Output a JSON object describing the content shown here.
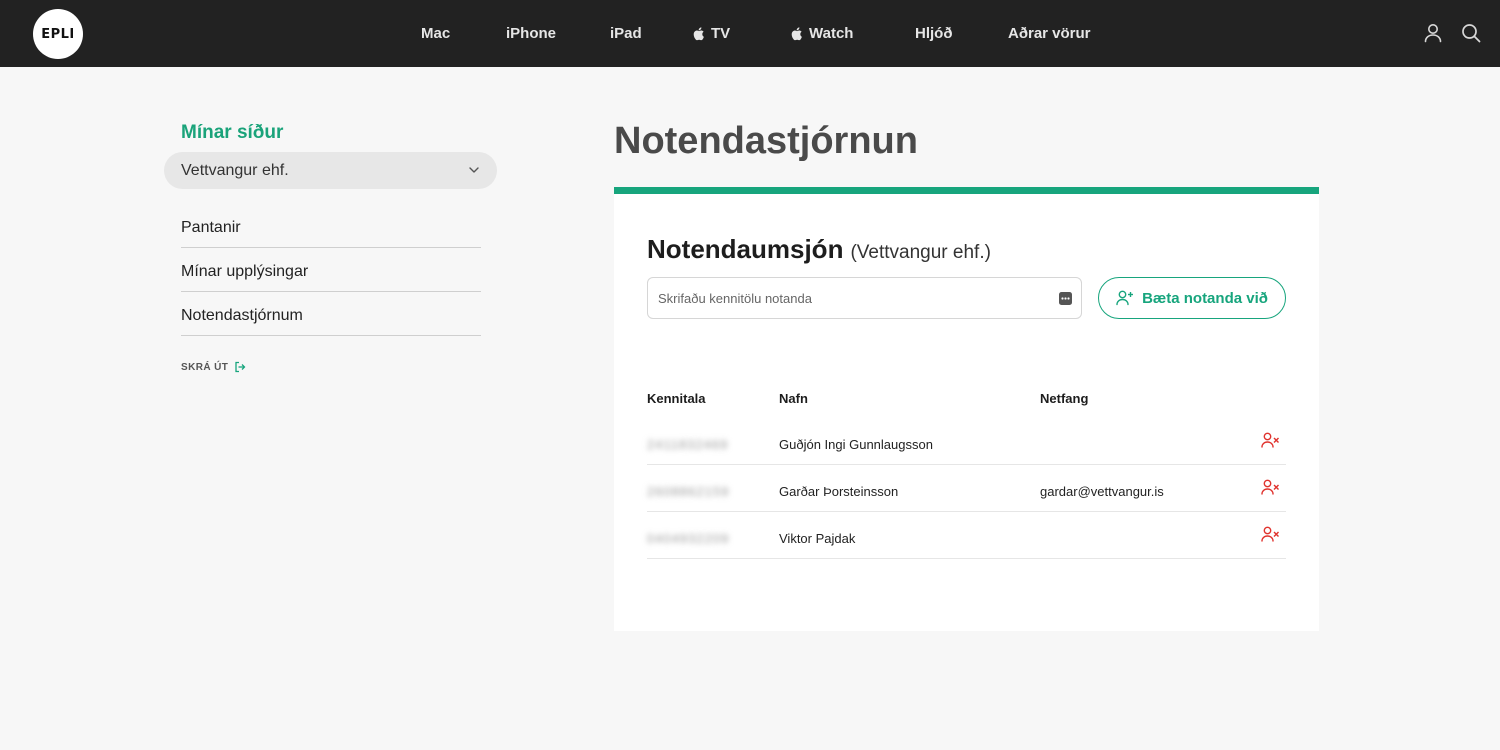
{
  "header": {
    "logo_text": "EPLI",
    "nav": [
      {
        "label": "Mac",
        "apple": false
      },
      {
        "label": "iPhone",
        "apple": false
      },
      {
        "label": "iPad",
        "apple": false
      },
      {
        "label": "TV",
        "apple": true
      },
      {
        "label": "Watch",
        "apple": true
      },
      {
        "label": "Hljóð",
        "apple": false
      },
      {
        "label": "Aðrar vörur",
        "apple": false
      }
    ],
    "icons": [
      "user-icon",
      "search-icon"
    ]
  },
  "sidebar": {
    "title": "Mínar síður",
    "company_select": "Vettvangur ehf.",
    "links": [
      "Pantanir",
      "Mínar upplýsingar",
      "Notendastjórnum"
    ],
    "logout": "SKRÁ ÚT"
  },
  "main": {
    "title": "Notendastjórnun",
    "panel": {
      "heading": "Notendaumsjón",
      "company": "(Vettvangur ehf.)",
      "search_placeholder": "Skrifaðu kennitölu notanda",
      "add_button": "Bæta notanda við"
    },
    "table": {
      "headers": [
        "Kennitala",
        "Nafn",
        "Netfang"
      ],
      "rows": [
        {
          "kennitala": "2411832469",
          "nafn": "Guðjón Ingi Gunnlaugsson",
          "netfang": ""
        },
        {
          "kennitala": "2608862159",
          "nafn": "Garðar Þorsteinsson",
          "netfang": "gardar@vettvangur.is"
        },
        {
          "kennitala": "0404932209",
          "nafn": "Viktor Pajdak",
          "netfang": ""
        }
      ]
    }
  },
  "colors": {
    "accent": "#17a57d",
    "topbar": "#222222",
    "danger": "#e0322d"
  }
}
